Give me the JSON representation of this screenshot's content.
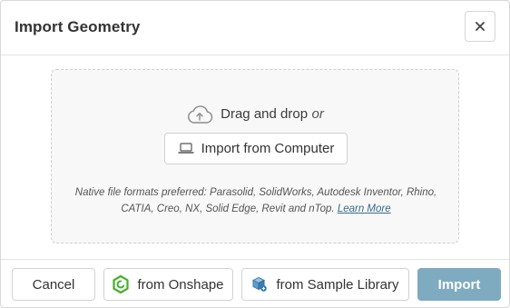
{
  "dialog": {
    "title": "Import Geometry",
    "close_symbol": "×"
  },
  "dropzone": {
    "drag_text": "Drag and drop",
    "or_text": "or",
    "upload_icon": "cloud-upload-icon",
    "import_computer_label": "Import from Computer",
    "computer_icon": "laptop-icon",
    "note_text": "Native file formats preferred: Parasolid, SolidWorks, Autodesk Inventor, Rhino, CATIA, Creo, NX, Solid Edge, Revit and nTop.",
    "learn_more_label": "Learn More"
  },
  "footer": {
    "cancel_label": "Cancel",
    "onshape_label": "from Onshape",
    "onshape_icon": "onshape-logo-icon",
    "sample_label": "from Sample Library",
    "sample_icon": "cube-icon",
    "import_label": "Import"
  },
  "colors": {
    "primary_disabled": "#7fabc0",
    "onshape_green": "#43b02a",
    "link": "#3a6a8a"
  }
}
